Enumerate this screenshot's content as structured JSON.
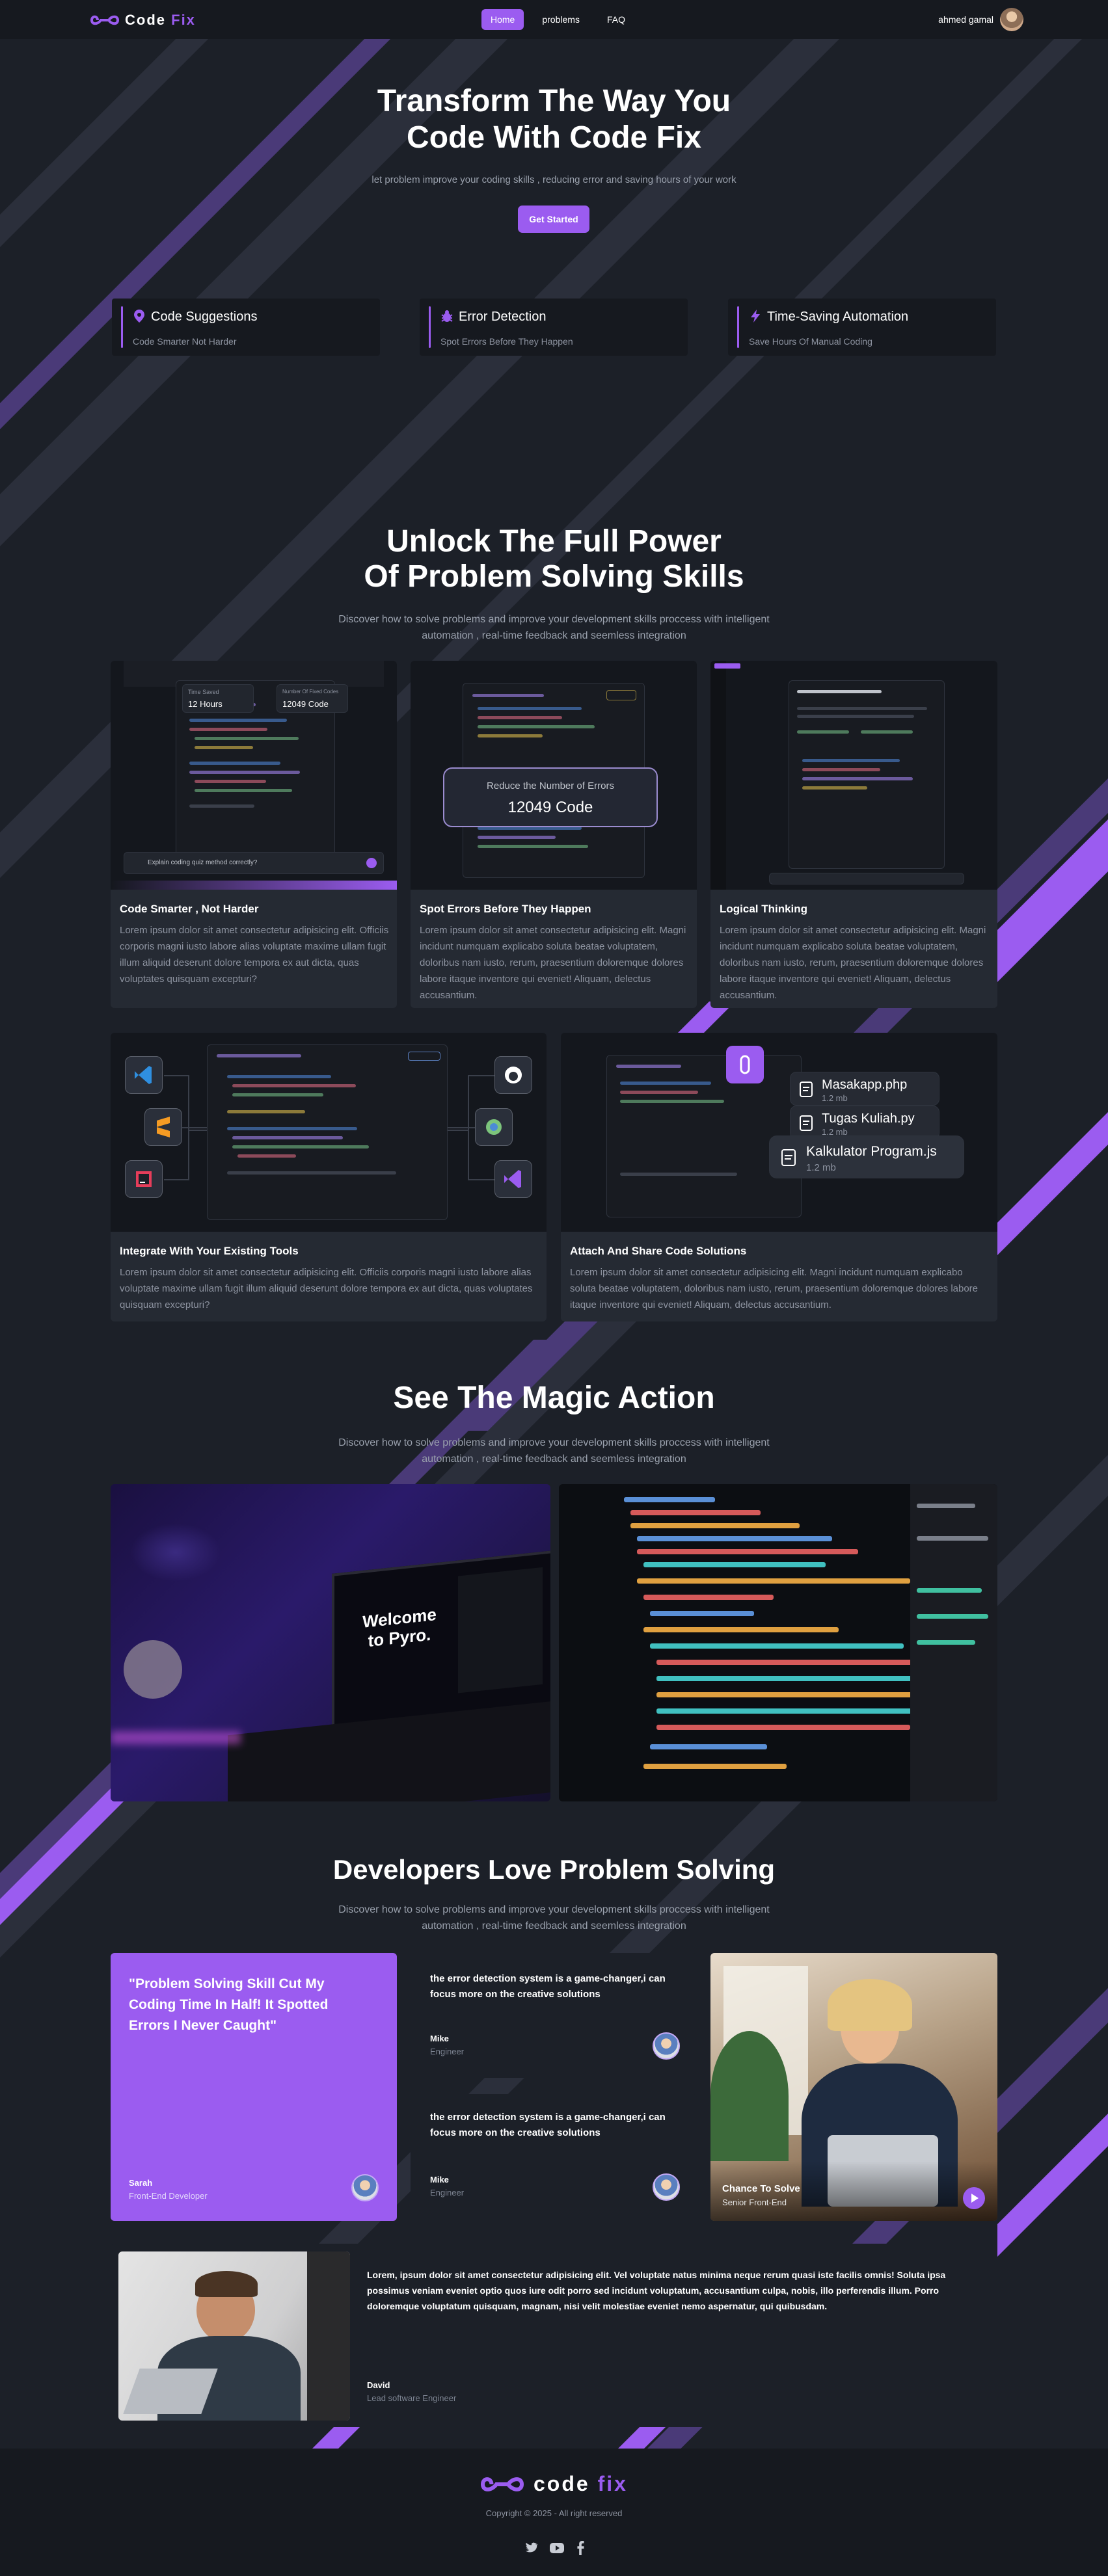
{
  "nav": {
    "logo_a": "Code",
    "logo_b": "Fix",
    "links": [
      "Home",
      "problems",
      "FAQ"
    ],
    "user_name": "ahmed gamal"
  },
  "hero": {
    "title_line1": "Transform The Way You",
    "title_line2": "Code With Code Fix",
    "subtitle": "let problem improve your coding skills , reducing error and saving hours of your work",
    "cta": "Get Started"
  },
  "features": [
    {
      "title": "Code Suggestions",
      "sub": "Code Smarter Not Harder",
      "icon": "pin-icon"
    },
    {
      "title": "Error Detection",
      "sub": "Spot Errors Before They Happen",
      "icon": "bug-icon"
    },
    {
      "title": "Time-Saving Automation",
      "sub": "Save Hours Of Manual Coding",
      "icon": "bolt-icon"
    }
  ],
  "power": {
    "title_line1": "Unlock The Full Power",
    "title_line2": "Of Problem Solving Skills",
    "subtitle_line1": "Discover how to solve problems and improve your development skills proccess with intelligent",
    "subtitle_line2": "automation , real-time feedback and seemless integration"
  },
  "cards_row1": [
    {
      "title": "Code Smarter , Not Harder",
      "desc": "Lorem ipsum dolor sit amet consectetur adipisicing elit. Officiis corporis magni iusto labore alias voluptate maxime ullam fugit illum aliquid deserunt dolore tempora ex aut dicta, quas voluptates quisquam excepturi?"
    },
    {
      "title": "Spot Errors Before They Happen",
      "desc": "Lorem ipsum dolor sit amet consectetur adipisicing elit. Magni incidunt numquam explicabo soluta beatae voluptatem, doloribus nam iusto, rerum, praesentium doloremque dolores labore itaque inventore qui eveniet! Aliquam, delectus accusantium."
    },
    {
      "title": "Logical Thinking",
      "desc": "Lorem ipsum dolor sit amet consectetur adipisicing elit. Magni incidunt numquam explicabo soluta beatae voluptatem, doloribus nam iusto, rerum, praesentium doloremque dolores labore itaque inventore qui eveniet! Aliquam, delectus accusantium."
    }
  ],
  "card1_img": {
    "saved_label": "Time Saved",
    "saved_value": "12 Hours",
    "fixed_label": "Number Of Fixed Codes",
    "fixed_value": "12049 Code",
    "prompt": "Explain coding quiz method correctly?"
  },
  "card2_img": {
    "label": "Reduce the Number of Errors",
    "value": "12049 Code"
  },
  "cards_row2": [
    {
      "title": "Integrate With Your Existing Tools",
      "desc": "Lorem ipsum dolor sit amet consectetur adipisicing elit. Officiis corporis magni iusto labore alias voluptate maxime ullam fugit illum aliquid deserunt dolore tempora ex aut dicta, quas voluptates quisquam excepturi?"
    },
    {
      "title": "Attach And Share Code Solutions",
      "desc": "Lorem ipsum dolor sit amet consectetur adipisicing elit. Magni incidunt numquam explicabo soluta beatae voluptatem, doloribus nam iusto, rerum, praesentium doloremque dolores labore itaque inventore qui eveniet! Aliquam, delectus accusantium."
    }
  ],
  "files": [
    {
      "name": "Masakapp.php",
      "size": "1.2 mb"
    },
    {
      "name": "Tugas Kuliah.py",
      "size": "1.2 mb"
    },
    {
      "name": "Kalkulator Program.js",
      "size": "1.2 mb"
    }
  ],
  "magic": {
    "title": "See The Magic Action",
    "subtitle_line1": "Discover how to solve problems and improve your development skills proccess with intelligent",
    "subtitle_line2": "automation , real-time feedback and seemless integration",
    "laptop_line1": "Welcome",
    "laptop_line2": "to Pyro."
  },
  "love": {
    "title": "Developers Love Problem Solving",
    "subtitle_line1": "Discover how to solve problems and improve your development skills proccess with intelligent",
    "subtitle_line2": "automation , real-time feedback and seemless integration"
  },
  "testimonials": {
    "featured": {
      "quote": "\"Problem Solving Skill Cut My Coding Time In Half! It Spotted Errors I Never Caught\"",
      "name": "Sarah",
      "role": "Front-End Developer"
    },
    "small": [
      {
        "quote": "the error detection system is a game-changer,i can focus more on the creative solutions",
        "name": "Mike",
        "role": "Engineer"
      },
      {
        "quote": "the error detection system is a game-changer,i can focus more on the creative solutions",
        "name": "Mike",
        "role": "Engineer"
      }
    ],
    "photo": {
      "name": "Chance To Solve",
      "role": "Senior Front-End"
    },
    "wide": {
      "quote": "Lorem, ipsum dolor sit amet consectetur adipisicing elit. Vel voluptate natus minima neque rerum quasi iste facilis omnis! Soluta ipsa possimus veniam eveniet optio quos iure odit porro sed incidunt voluptatum, accusantium culpa, nobis, illo perferendis illum. Porro doloremque voluptatum quisquam, magnam, nisi velit molestiae eveniet nemo aspernatur, qui quibusdam.",
      "name": "David",
      "role": "Lead software Engineer"
    }
  },
  "footer": {
    "logo_a": "code",
    "logo_b": "fix",
    "copyright": "Copyright © 2025 - All right reserved",
    "social": [
      "twitter-icon",
      "youtube-icon",
      "facebook-icon"
    ]
  },
  "colors": {
    "accent": "#9b5cf0",
    "background": "#1c2028",
    "card": "#252a33"
  }
}
